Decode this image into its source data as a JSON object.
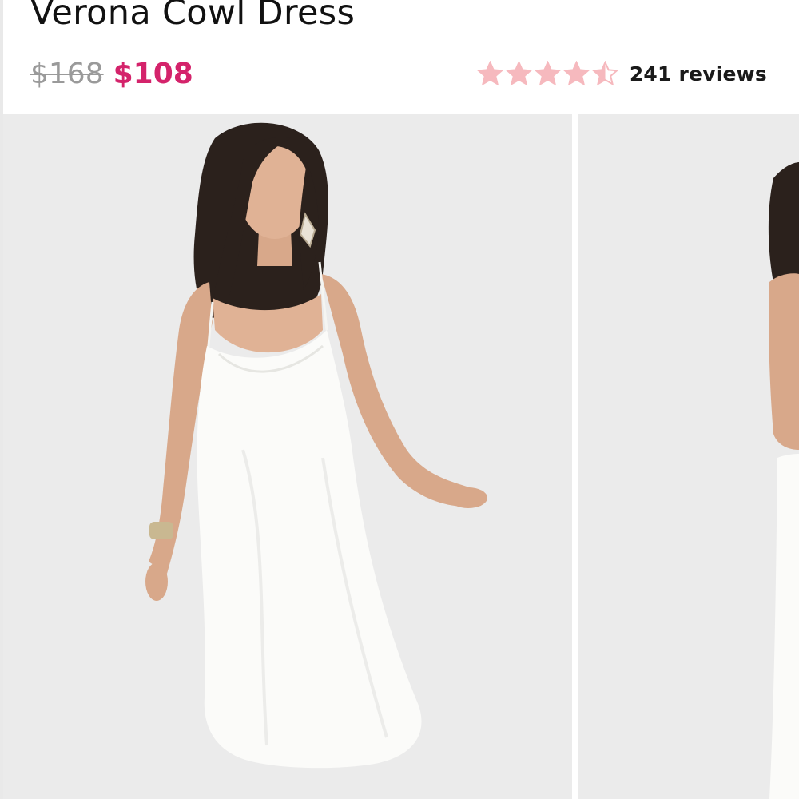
{
  "product": {
    "title": "Verona Cowl Dress",
    "price_original": "$168",
    "price_sale": "$108"
  },
  "rating": {
    "value": 4.5,
    "max": 5,
    "star_color": "#f6b9be",
    "reviews_label": "241 reviews"
  },
  "colors": {
    "sale_price": "#d4236b",
    "original_price": "#9a9a9a",
    "photo_background": "#ebebeb"
  },
  "gallery": {
    "images": [
      {
        "alt": "Model wearing white satin cowl neck slip midi dress, front view"
      },
      {
        "alt": "Model wearing white satin cowl neck slip midi dress, side view (partially visible)"
      }
    ]
  }
}
